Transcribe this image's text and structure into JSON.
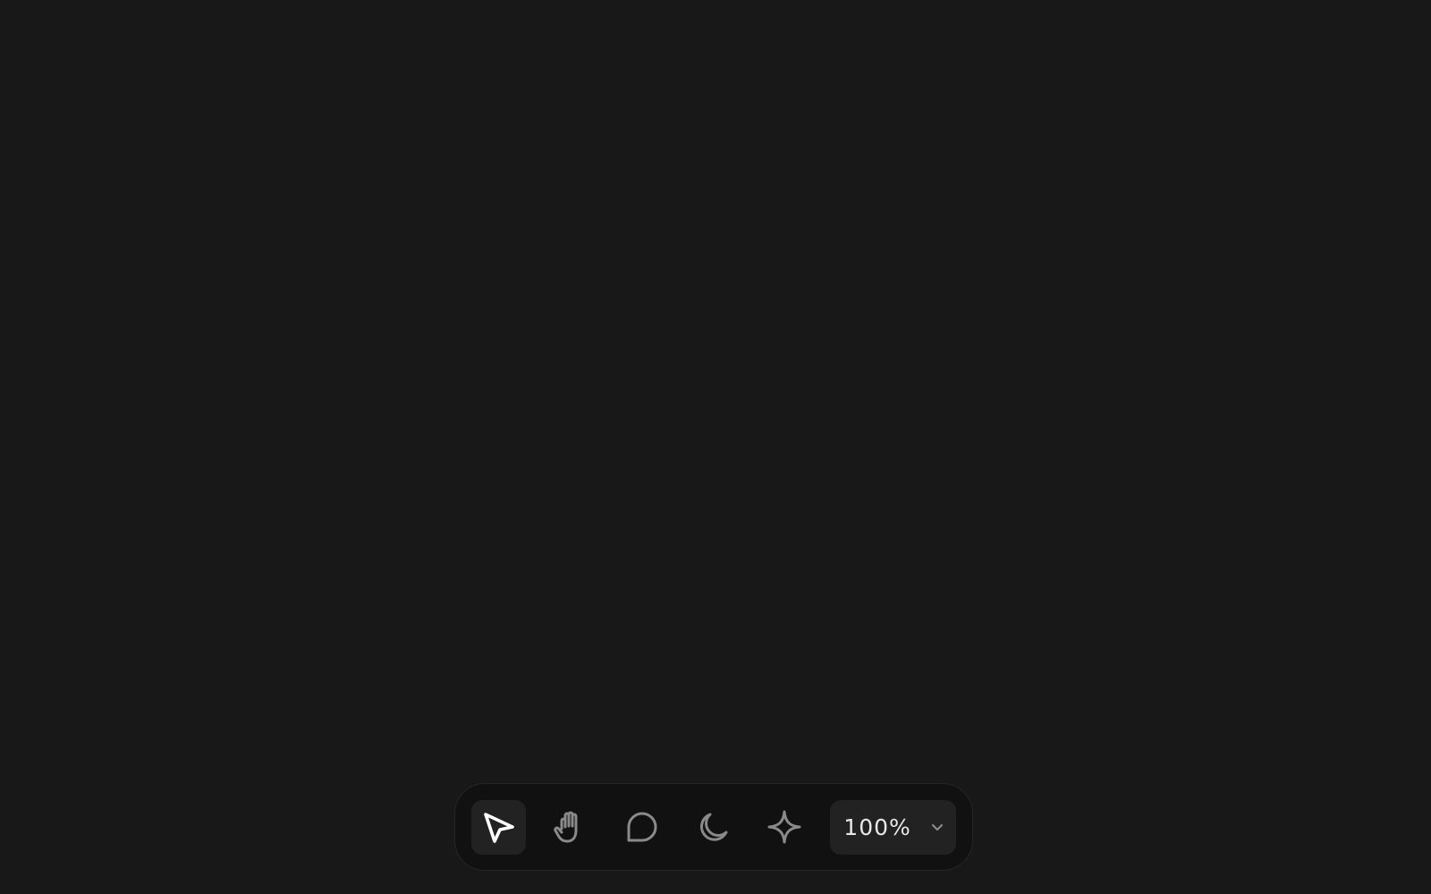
{
  "toolbar": {
    "tools": [
      {
        "name": "select",
        "icon": "cursor-arrow-icon",
        "active": true
      },
      {
        "name": "hand",
        "icon": "hand-icon",
        "active": false
      },
      {
        "name": "comment",
        "icon": "comment-bubble-icon",
        "active": false
      },
      {
        "name": "theme",
        "icon": "moon-icon",
        "active": false
      },
      {
        "name": "ai",
        "icon": "sparkle-icon",
        "active": false
      }
    ],
    "zoom": {
      "value": "100%",
      "icon": "chevron-down-icon"
    }
  },
  "colors": {
    "canvas": "#181818",
    "toolbar_bg": "#111111",
    "active_tool_bg": "#222222",
    "icon_active": "#ffffff",
    "icon_inactive": "#8a8a8a"
  }
}
